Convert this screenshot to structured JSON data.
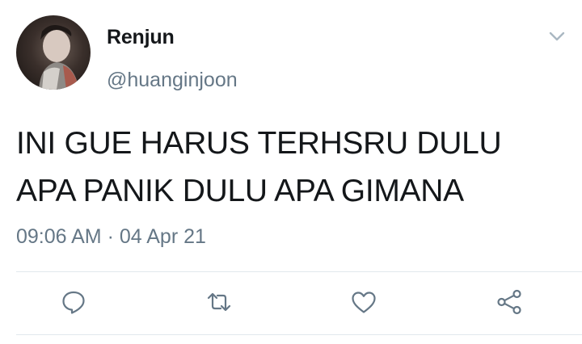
{
  "tweet": {
    "author": {
      "display_name": "Renjun",
      "handle": "@huanginjoon",
      "avatar_icon": "profile-photo"
    },
    "text_lines": [
      "INI GUE HARUS TERHSRU DULU",
      "APA PANIK DULU APA GIMANA"
    ],
    "time": "09:06 AM",
    "separator": "·",
    "date": "04 Apr 21"
  },
  "actions": [
    {
      "icon": "reply-icon"
    },
    {
      "icon": "retweet-icon"
    },
    {
      "icon": "heart-icon"
    },
    {
      "icon": "share-icon"
    }
  ],
  "colors": {
    "text_primary": "#14171a",
    "text_secondary": "#657786",
    "icon": "#657786",
    "divider": "#e1e8ed",
    "caret": "#aab8c2"
  }
}
